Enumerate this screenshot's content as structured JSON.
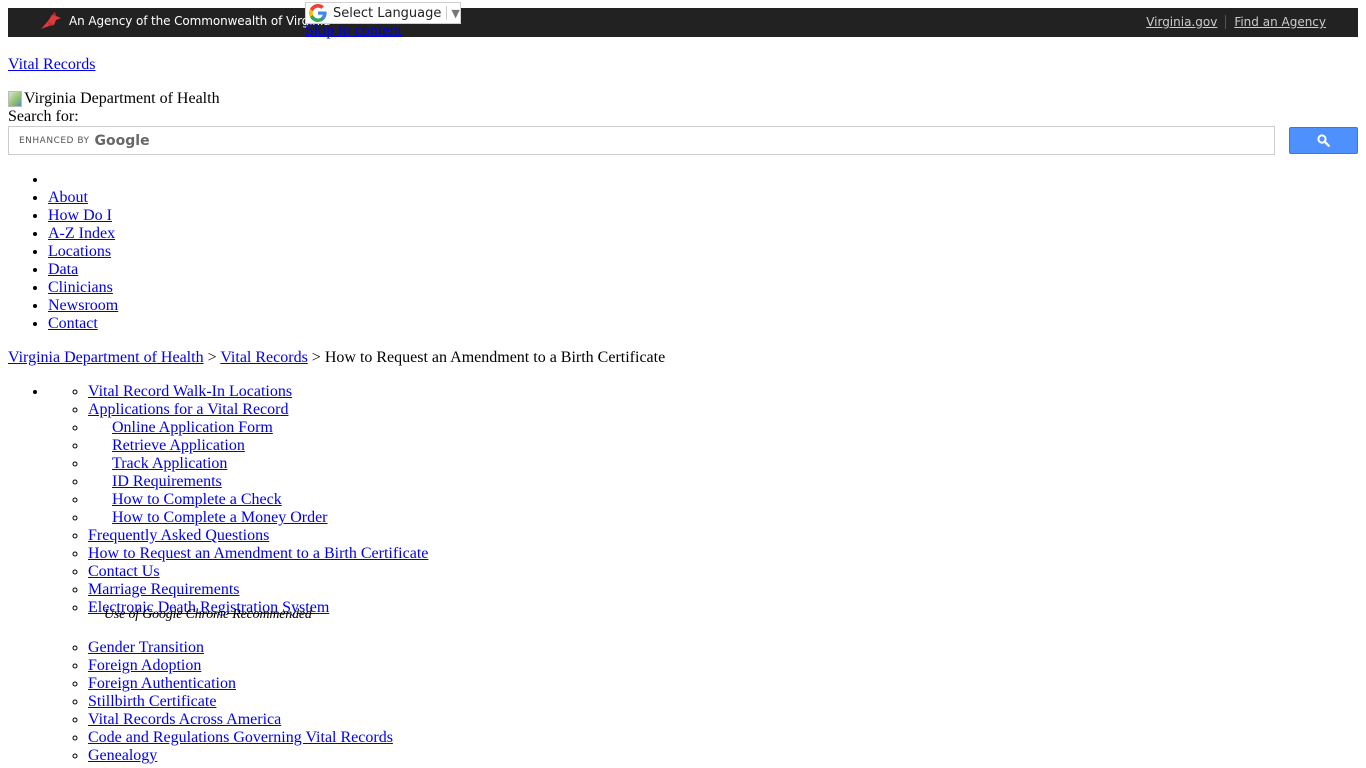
{
  "topbar": {
    "agency_text": "An Agency of the Commonwealth of Virginia",
    "links": [
      {
        "label": "Virginia.gov"
      },
      {
        "label": "Find an Agency"
      }
    ],
    "background_color": "#222222",
    "logo_color": "#e03a3e"
  },
  "language": {
    "label": "Select Language",
    "arrow": "▼"
  },
  "skip_link": "Skip to content",
  "site_link": "Vital Records",
  "brand_image_alt": "Virginia Department of Health",
  "search": {
    "label": "Search for:",
    "enhanced_by": "ENHANCED BY",
    "google": "Google",
    "value": "",
    "button_color": "#4d90fe"
  },
  "nav": {
    "items": [
      {
        "label": ""
      },
      {
        "label": "About"
      },
      {
        "label": "How Do I"
      },
      {
        "label": "A-Z Index"
      },
      {
        "label": "Locations"
      },
      {
        "label": "Data"
      },
      {
        "label": "Clinicians"
      },
      {
        "label": "Newsroom"
      },
      {
        "label": "Contact"
      }
    ]
  },
  "breadcrumb": {
    "items": [
      {
        "label": "Virginia Department of Health"
      },
      {
        "label": "Vital Records"
      }
    ],
    "separator": ">",
    "current": "How to Request an Amendment to a Birth Certificate"
  },
  "sidebar": {
    "items": [
      {
        "label": "Vital Record Walk-In Locations"
      },
      {
        "label": "Applications for a Vital Record"
      },
      {
        "label": "Online Application Form"
      },
      {
        "label": "Retrieve Application"
      },
      {
        "label": "Track Application"
      },
      {
        "label": "ID Requirements"
      },
      {
        "label": "How to Complete a Check"
      },
      {
        "label": "How to Complete a Money Order"
      },
      {
        "label": "Frequently Asked Questions"
      },
      {
        "label": "How to Request an Amendment to a Birth Certificate"
      },
      {
        "label": "Contact Us"
      },
      {
        "label": "Marriage Requirements"
      },
      {
        "label": "Electronic Death Registration System"
      },
      {
        "label": "Gender Transition"
      },
      {
        "label": "Foreign Adoption"
      },
      {
        "label": "Foreign Authentication"
      },
      {
        "label": "Stillbirth Certificate"
      },
      {
        "label": "Vital Records Across America"
      },
      {
        "label": "Code and Regulations Governing Vital Records"
      },
      {
        "label": "Genealogy"
      }
    ],
    "edrs_note": "Use of Google Chrome Recommended"
  }
}
